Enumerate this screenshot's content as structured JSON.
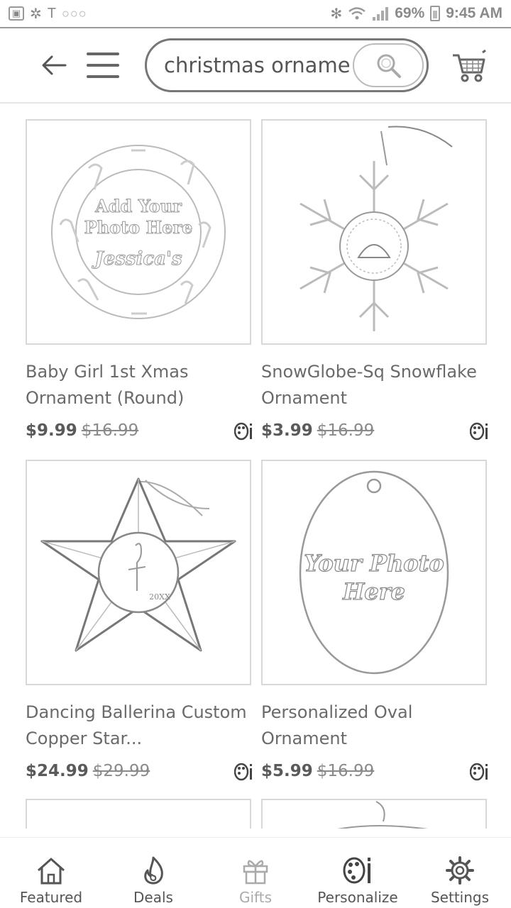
{
  "status_bar": {
    "battery": "69%",
    "time": "9:45 AM"
  },
  "header": {
    "search": {
      "value": "christmas ornaments",
      "display": "christmas orname"
    }
  },
  "products": [
    {
      "title": "Baby Girl 1st Xmas Ornament (Round)",
      "price": "$9.99",
      "original_price": "$16.99",
      "image_text": [
        "Add Your",
        "Photo Here",
        "Jessica's"
      ]
    },
    {
      "title": "SnowGlobe-Sq Snowflake Ornament",
      "price": "$3.99",
      "original_price": "$16.99"
    },
    {
      "title": "Dancing Ballerina Custom Copper Star...",
      "price": "$24.99",
      "original_price": "$29.99",
      "image_text": [
        "20XX"
      ]
    },
    {
      "title": "Personalized Oval Ornament",
      "price": "$5.99",
      "original_price": "$16.99",
      "image_text": [
        "Your Photo",
        "Here"
      ]
    }
  ],
  "bottom_nav": {
    "items": [
      {
        "label": "Featured",
        "icon": "home-icon"
      },
      {
        "label": "Deals",
        "icon": "flame-icon"
      },
      {
        "label": "Gifts",
        "icon": "gift-icon"
      },
      {
        "label": "Personalize",
        "icon": "palette-icon"
      },
      {
        "label": "Settings",
        "icon": "gear-icon"
      }
    ]
  },
  "colors": {
    "text": "#555555",
    "border": "#d8d8d8",
    "muted": "#aaaaaa"
  }
}
